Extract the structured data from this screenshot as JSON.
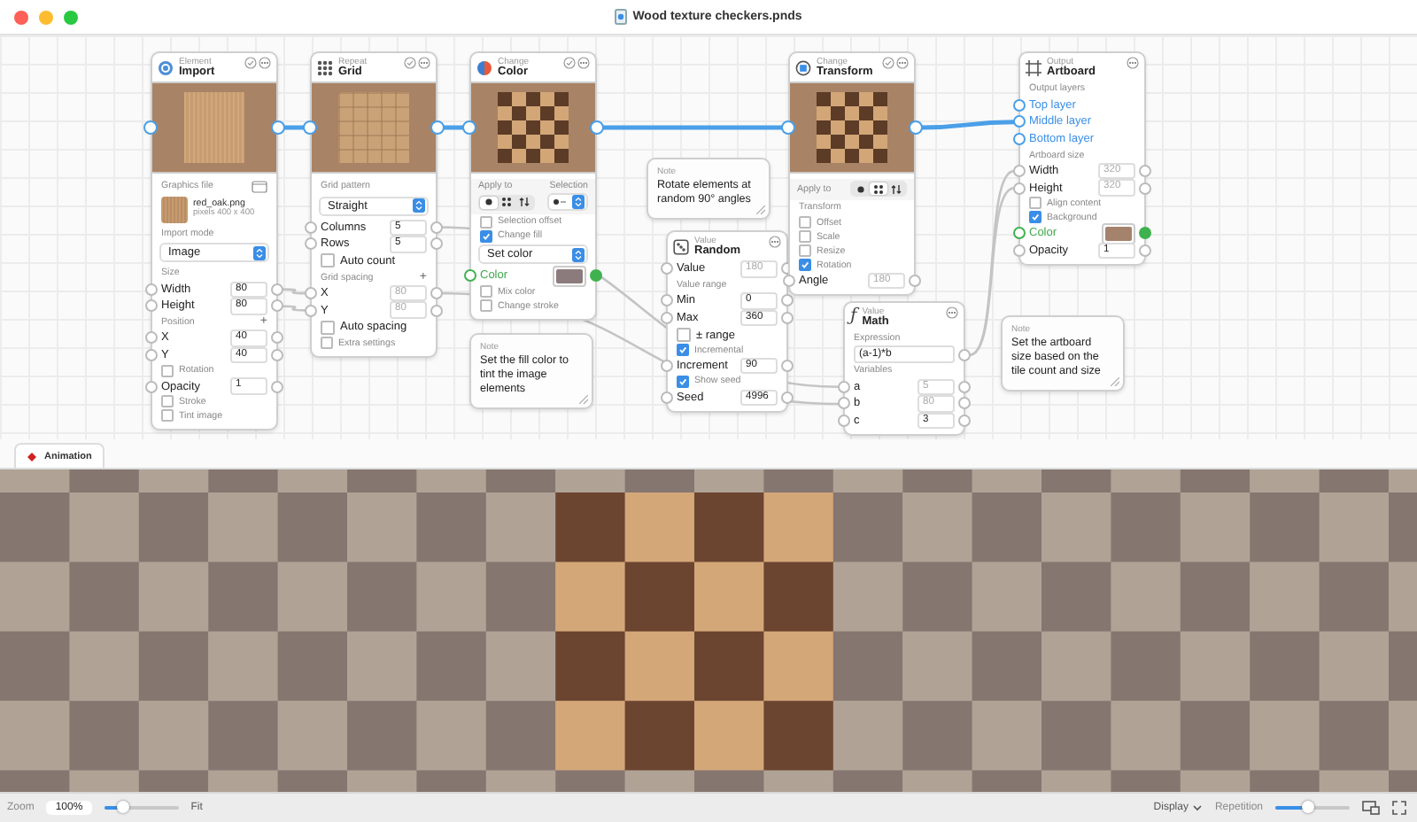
{
  "window": {
    "title": "Wood texture checkers.pnds"
  },
  "nodes": [
    {
      "kind": "import",
      "category": "Element",
      "title": "Import",
      "enable_button": true,
      "rows": [
        {
          "kind": "file_section",
          "label": "Graphics file"
        },
        {
          "kind": "file",
          "name": "red_oak.png",
          "info": "pixels 400 x 400"
        },
        {
          "kind": "section",
          "label": "Import mode"
        },
        {
          "kind": "select",
          "value": "Image"
        },
        {
          "kind": "section",
          "label": "Size"
        },
        {
          "kind": "field",
          "label": "Width",
          "value": "80",
          "disabled": false
        },
        {
          "kind": "field",
          "label": "Height",
          "value": "80",
          "disabled": false
        },
        {
          "kind": "section",
          "label": "Position",
          "add": "+"
        },
        {
          "kind": "field",
          "label": "X",
          "value": "40",
          "disabled": false
        },
        {
          "kind": "field",
          "label": "Y",
          "value": "40",
          "disabled": false
        },
        {
          "kind": "option",
          "label": "Rotation",
          "checked": false
        },
        {
          "kind": "field",
          "label": "Opacity",
          "value": "1",
          "disabled": false
        },
        {
          "kind": "option",
          "label": "Stroke",
          "checked": false
        },
        {
          "kind": "option",
          "label": "Tint image",
          "checked": false
        }
      ]
    },
    {
      "kind": "grid",
      "category": "Repeat",
      "title": "Grid",
      "enable_button": true,
      "rows": [
        {
          "kind": "section",
          "label": "Grid pattern"
        },
        {
          "kind": "select",
          "value": "Straight"
        },
        {
          "kind": "field",
          "label": "Columns",
          "value": "5",
          "disabled": false
        },
        {
          "kind": "field",
          "label": "Rows",
          "value": "5",
          "disabled": false
        },
        {
          "kind": "check",
          "label": "Auto count",
          "checked": false
        },
        {
          "kind": "section",
          "label": "Grid spacing",
          "add": "+"
        },
        {
          "kind": "field",
          "label": "X",
          "value": "80",
          "disabled": true
        },
        {
          "kind": "field",
          "label": "Y",
          "value": "80",
          "disabled": true
        },
        {
          "kind": "check",
          "label": "Auto spacing",
          "checked": false
        },
        {
          "kind": "option",
          "label": "Extra settings",
          "checked": false
        }
      ]
    },
    {
      "kind": "color",
      "category": "Change",
      "title": "Color",
      "enable_button": true,
      "rows": [
        {
          "kind": "apply",
          "label": "Apply to",
          "label2": "Selection",
          "segments": [
            {
              "selected": true
            },
            {
              "selected": false
            },
            {
              "selected": false
            }
          ]
        },
        {
          "kind": "option",
          "label": "Selection offset",
          "checked": false
        },
        {
          "kind": "option",
          "label": "Change fill",
          "checked": true
        },
        {
          "kind": "select",
          "value": "Set color"
        },
        {
          "kind": "color",
          "label": "Color",
          "color": "#8b7b7c"
        },
        {
          "kind": "option",
          "label": "Mix color",
          "checked": false
        },
        {
          "kind": "option",
          "label": "Change stroke",
          "checked": false
        }
      ]
    },
    {
      "kind": "note",
      "category": "Note",
      "text": "Set the fill color to tint the image elements"
    },
    {
      "kind": "note",
      "category": "Note",
      "text": "Rotate elements at random 90° angles"
    },
    {
      "kind": "random",
      "category": "Value",
      "title": "Random",
      "enable_button": false,
      "rows": [
        {
          "kind": "field",
          "label": "Value",
          "value": "180",
          "disabled": true
        },
        {
          "kind": "section",
          "label": "Value range"
        },
        {
          "kind": "field",
          "label": "Min",
          "value": "0",
          "disabled": false
        },
        {
          "kind": "field",
          "label": "Max",
          "value": "360",
          "disabled": false
        },
        {
          "kind": "check",
          "label": "± range",
          "checked": false
        },
        {
          "kind": "option",
          "label": "Incremental",
          "checked": true
        },
        {
          "kind": "field",
          "label": "Increment",
          "value": "90",
          "disabled": false
        },
        {
          "kind": "option",
          "label": "Show seed",
          "checked": true
        },
        {
          "kind": "field",
          "label": "Seed",
          "value": "4996",
          "disabled": false
        }
      ]
    },
    {
      "kind": "transform",
      "category": "Change",
      "title": "Transform",
      "enable_button": true,
      "rows": [
        {
          "kind": "apply",
          "label": "Apply to",
          "segments": [
            {
              "selected": false
            },
            {
              "selected": true
            },
            {
              "selected": false
            }
          ]
        },
        {
          "kind": "section",
          "label": "Transform"
        },
        {
          "kind": "option",
          "label": "Offset",
          "checked": false
        },
        {
          "kind": "option",
          "label": "Scale",
          "checked": false
        },
        {
          "kind": "option",
          "label": "Resize",
          "checked": false
        },
        {
          "kind": "option",
          "label": "Rotation",
          "checked": true
        },
        {
          "kind": "field",
          "label": "Angle",
          "value": "180",
          "disabled": true
        }
      ]
    },
    {
      "kind": "math",
      "category": "Value",
      "title": "Math",
      "symbol": "ƒ",
      "enable_button": false,
      "rows": [
        {
          "kind": "section",
          "label": "Expression"
        },
        {
          "kind": "expr",
          "value": "(a-1)*b"
        },
        {
          "kind": "section",
          "label": "Variables"
        },
        {
          "kind": "field",
          "label": "a",
          "value": "5",
          "disabled": true
        },
        {
          "kind": "field",
          "label": "b",
          "value": "80",
          "disabled": true
        },
        {
          "kind": "field",
          "label": "c",
          "value": "3",
          "disabled": false
        }
      ]
    },
    {
      "kind": "artboard",
      "category": "Output",
      "title": "Artboard",
      "enable_button": false,
      "rows": [
        {
          "kind": "section",
          "label": "Output layers"
        },
        {
          "kind": "layer",
          "label": "Top layer"
        },
        {
          "kind": "layer",
          "label": "Middle layer"
        },
        {
          "kind": "layer",
          "label": "Bottom layer"
        },
        {
          "kind": "section",
          "label": "Artboard size"
        },
        {
          "kind": "field",
          "label": "Width",
          "value": "320",
          "disabled": true
        },
        {
          "kind": "field",
          "label": "Height",
          "value": "320",
          "disabled": true
        },
        {
          "kind": "option",
          "label": "Align content",
          "checked": false
        },
        {
          "kind": "option",
          "label": "Background",
          "checked": true
        },
        {
          "kind": "color",
          "label": "Color",
          "color": "#a5826c"
        },
        {
          "kind": "field",
          "label": "Opacity",
          "value": "1",
          "disabled": false
        }
      ]
    },
    {
      "kind": "note",
      "category": "Note",
      "text": "Set the artboard size based on the tile count and size"
    }
  ],
  "tabs": [
    {
      "label": "Animation",
      "selected": true
    }
  ],
  "toolbar": {
    "zoom_label": "Zoom",
    "zoom_value": "100%",
    "zoom_slider": {
      "level": 0.25
    },
    "fit": "Fit",
    "display": "Display",
    "repetition_label": "Repetition",
    "repetition_slider": {
      "level": 0.45
    }
  }
}
